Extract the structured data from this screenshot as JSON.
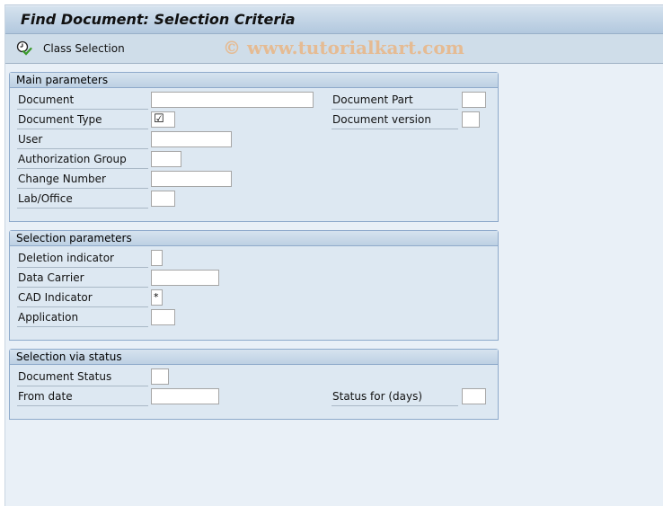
{
  "window": {
    "title": "Find Document: Selection Criteria"
  },
  "toolbar": {
    "class_selection_label": "Class Selection",
    "class_selection_icon": "execute-clock-check-icon"
  },
  "watermark": "© www.tutorialkart.com",
  "groups": {
    "main": {
      "title": "Main parameters",
      "fields": {
        "document": {
          "label": "Document",
          "value": ""
        },
        "document_type": {
          "label": "Document Type",
          "value": "☑"
        },
        "user": {
          "label": "User",
          "value": ""
        },
        "authorization_group": {
          "label": "Authorization Group",
          "value": ""
        },
        "change_number": {
          "label": "Change Number",
          "value": ""
        },
        "lab_office": {
          "label": "Lab/Office",
          "value": ""
        },
        "document_part": {
          "label": "Document Part",
          "value": ""
        },
        "document_version": {
          "label": "Document version",
          "value": ""
        }
      }
    },
    "selection": {
      "title": "Selection parameters",
      "fields": {
        "deletion_indicator": {
          "label": "Deletion indicator",
          "value": ""
        },
        "data_carrier": {
          "label": "Data Carrier",
          "value": ""
        },
        "cad_indicator": {
          "label": "CAD Indicator",
          "value": "*"
        },
        "application": {
          "label": "Application",
          "value": ""
        }
      }
    },
    "status": {
      "title": "Selection via status",
      "fields": {
        "document_status": {
          "label": "Document Status",
          "value": ""
        },
        "from_date": {
          "label": "From date",
          "value": ""
        },
        "status_for_days": {
          "label": "Status for (days)",
          "value": ""
        }
      }
    }
  }
}
